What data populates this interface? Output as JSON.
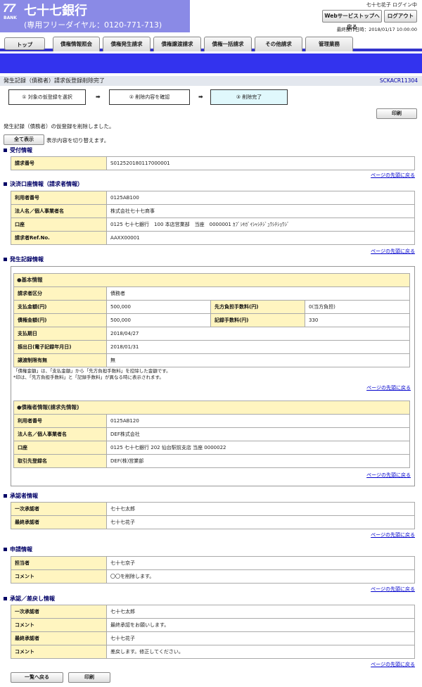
{
  "header": {
    "logo_num": "77",
    "logo_bank": "BANK",
    "bank_name": "七十七銀行",
    "tel": "(専用フリーダイヤル：0120-771-713)",
    "user": "七十七花子 ログイン中",
    "web_top_button": "Webサービストップへ戻る",
    "logout_button": "ログアウト",
    "last_operation": "最終操作日時：2018/01/17 10:00:00"
  },
  "nav": [
    "トップ",
    "債権情報照会",
    "債権発生請求",
    "債権譲渡請求",
    "債権一括請求",
    "その他請求",
    "管理業務"
  ],
  "page": {
    "title": "発生記録（債務者）請求仮登録削除完了",
    "screen_id": "SCKACR11304"
  },
  "steps": [
    "① 対象の仮登録を選択",
    "② 削除内容を確認",
    "③ 削除完了"
  ],
  "arrow": "➡",
  "print_button": "印刷",
  "message": "発生記録（債務者）の仮登録を削除しました。",
  "show_all_button": "全て表示",
  "show_all_text": "表示内容を切り替えます。",
  "page_top_link": "ページの先頭に戻る",
  "reception": {
    "title": "受付情報",
    "rows": [
      {
        "label": "請求番号",
        "value": "S012520180117000001"
      }
    ]
  },
  "account": {
    "title": "決済口座情報（請求者情報）",
    "rows": [
      {
        "label": "利用者番号",
        "value": "0125AB100"
      },
      {
        "label": "法人名／個人事業者名",
        "value": "株式会社七十七商事"
      },
      {
        "label": "口座",
        "value": "0125 七十七銀行　100 本店営業部　当座　0000001 ｶﾌﾞｼｷｶﾞｲｼｬｼﾁｼﾞｭｳｼﾁｼｮｳｼﾞ"
      },
      {
        "label": "請求者Ref.No.",
        "value": "AAXX00001"
      }
    ]
  },
  "issuance": {
    "title": "発生記録情報",
    "basic_title": "●基本情報",
    "debtor_type": {
      "label": "請求者区分",
      "value": "債務者"
    },
    "amount": {
      "label": "支払金額(円)",
      "value": "500,000"
    },
    "fee_burden": {
      "label": "先方負担手数料(円)",
      "value": "0(当方負担)"
    },
    "claim_amount": {
      "label": "債権金額(円)",
      "value": "500,000"
    },
    "record_fee": {
      "label": "記録手数料(円)",
      "value": "330"
    },
    "due_date": {
      "label": "支払期日",
      "value": "2018/04/27"
    },
    "issue_date": {
      "label": "振出日(電子記録年月日)",
      "value": "2018/01/31"
    },
    "transfer_limit": {
      "label": "譲渡制限有無",
      "value": "無"
    },
    "note1": "「債権金額」は、「支払金額」から「先方負担手数料」を控除した金額です。",
    "note2": "*印は、「先方負担手数料」と「記録手数料」が異なる時に表示されます。",
    "creditor_title": "●債権者情報(請求先情報)",
    "creditor_rows": [
      {
        "label": "利用者番号",
        "value": "0125AB120"
      },
      {
        "label": "法人名／個人事業者名",
        "value": "DEF株式会社"
      },
      {
        "label": "口座",
        "value": "0125 七十七銀行 202 仙台駅前支店 当座 0000022"
      },
      {
        "label": "取引先登録名",
        "value": "DEF(株)営業部"
      }
    ]
  },
  "approvers": {
    "title": "承認者情報",
    "rows": [
      {
        "label": "一次承認者",
        "value": "七十七太郎"
      },
      {
        "label": "最終承認者",
        "value": "七十七花子"
      }
    ]
  },
  "application": {
    "title": "申請情報",
    "rows": [
      {
        "label": "担当者",
        "value": "七十七京子"
      },
      {
        "label": "コメント",
        "value": "〇〇を削除します。"
      }
    ]
  },
  "approval_return": {
    "title": "承認／差戻し情報",
    "rows": [
      {
        "label": "一次承認者",
        "value": "七十七太郎"
      },
      {
        "label": "コメント",
        "value": "最終承認をお願いします。"
      },
      {
        "label": "最終承認者",
        "value": "七十七花子"
      },
      {
        "label": "コメント",
        "value": "差戻します。修正してください。"
      }
    ]
  },
  "back_button": "一覧へ戻る"
}
